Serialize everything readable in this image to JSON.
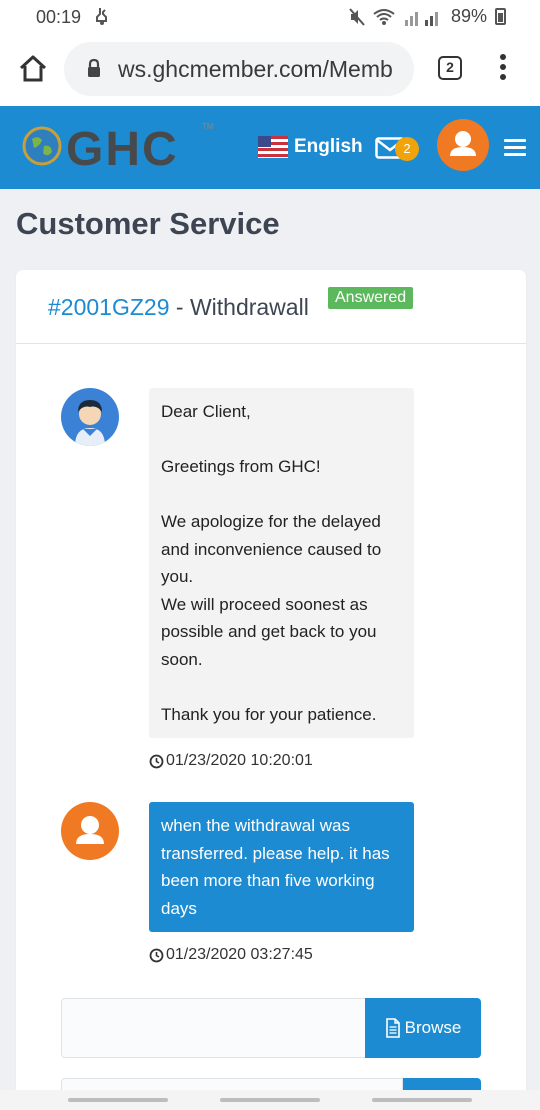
{
  "status_bar": {
    "time": "00:19",
    "battery": "89%"
  },
  "browser": {
    "url": "ws.ghcmember.com/Memb",
    "tab_count": "2"
  },
  "header": {
    "logo_text": "GHC",
    "logo_tm": "TM",
    "language": "English",
    "mail_count": "2",
    "colors": {
      "header_bg": "#1c8bd1",
      "avatar_bg": "#f07a23",
      "badge_bg": "#f0a30a"
    }
  },
  "page": {
    "title": "Customer Service"
  },
  "ticket": {
    "id": "#2001GZ29",
    "separator": " - ",
    "subject": "Withdrawall",
    "status": "Answered",
    "status_color": "#5cb85c"
  },
  "messages": [
    {
      "from": "support",
      "lines": [
        "Dear Client,",
        "",
        "Greetings from GHC!",
        "",
        "We apologize for the delayed and inconvenience caused to you.",
        "We will proceed soonest as possible and get back to you soon.",
        "",
        "Thank you for your patience."
      ],
      "timestamp": "01/23/2020 10:20:01"
    },
    {
      "from": "user",
      "text": "when the withdrawal was transferred. please help. it has been more than five working days",
      "timestamp": "01/23/2020 03:27:45"
    }
  ],
  "reply": {
    "browse_label": "Browse"
  }
}
